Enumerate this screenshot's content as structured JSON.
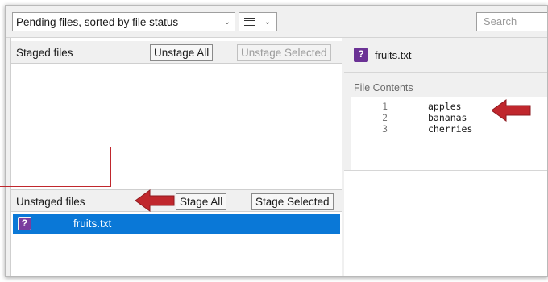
{
  "toolbar": {
    "filter_label": "Pending files, sorted by file status",
    "search_placeholder": "Search"
  },
  "staged": {
    "title": "Staged files",
    "unstage_all": "Unstage All",
    "unstage_selected": "Unstage Selected"
  },
  "unstaged": {
    "title": "Unstaged files",
    "stage_all": "Stage All",
    "stage_selected": "Stage Selected",
    "files": [
      {
        "status": "?",
        "name": "fruits.txt"
      }
    ]
  },
  "diff": {
    "status": "?",
    "file_name": "fruits.txt",
    "contents_label": "File Contents",
    "lines": [
      {
        "num": "1",
        "text": "apples"
      },
      {
        "num": "2",
        "text": "bananas"
      },
      {
        "num": "3",
        "text": "cherries"
      }
    ]
  },
  "colors": {
    "selection": "#0a78d7",
    "untracked_status": "#7a3c9e",
    "annotation": "#c0272d"
  },
  "icons": [
    "chevron-down-icon",
    "list-view-icon",
    "untracked-status-icon",
    "scroll-left-icon",
    "scroll-right-icon",
    "annotation-arrow-icon"
  ]
}
